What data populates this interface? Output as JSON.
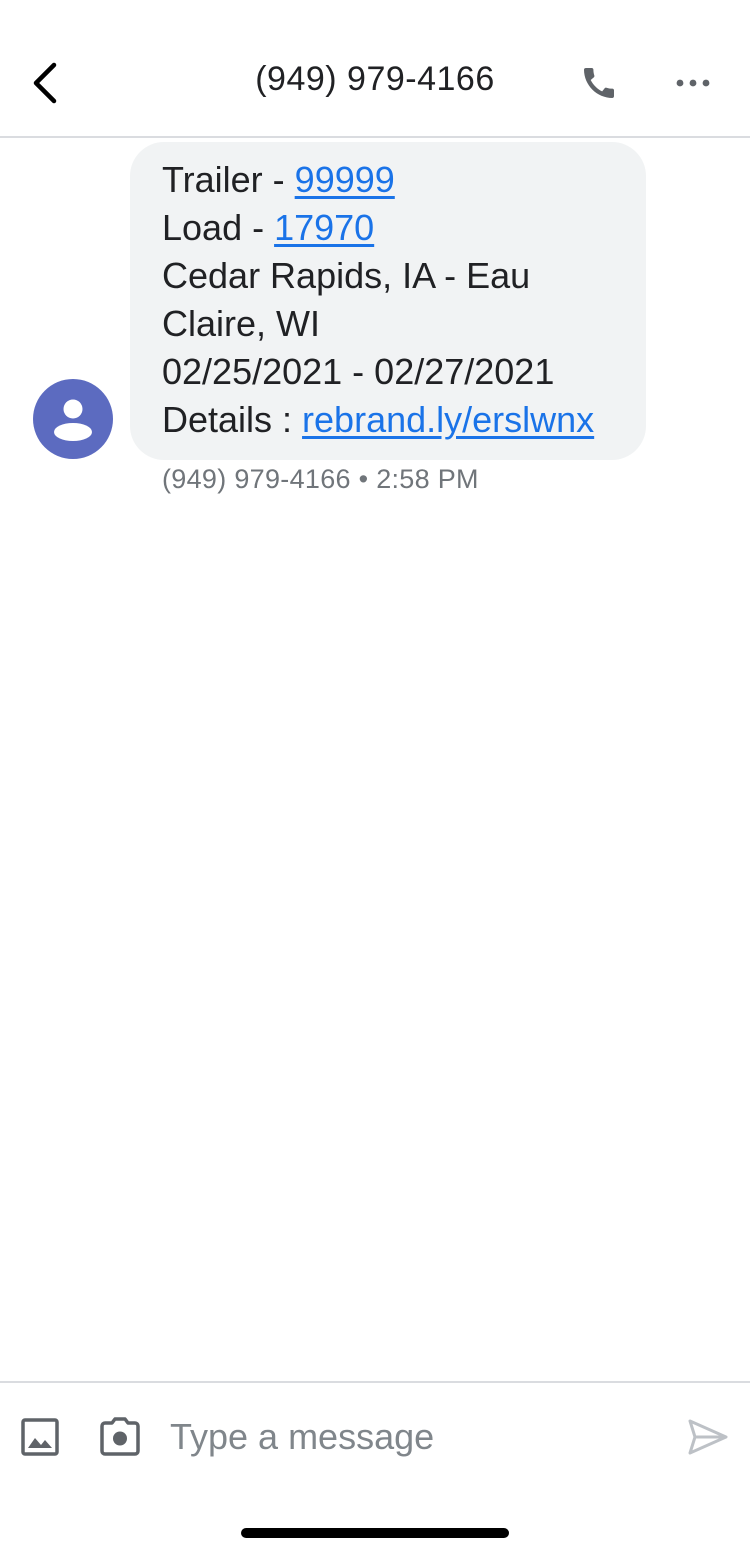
{
  "header": {
    "title": "(949) 979-4166",
    "icons": {
      "back": "chevron-left-icon",
      "call": "phone-icon",
      "more": "more-horizontal-icon"
    }
  },
  "conversation": {
    "avatar_icon": "person-icon",
    "avatar_color": "#5c6bc0",
    "message": {
      "trailer_label": "Trailer - ",
      "trailer_link": "99999",
      "load_label": "Load - ",
      "load_link": "17970",
      "route_line1": "Cedar Rapids, IA - Eau",
      "route_line2": "Claire, WI",
      "dates": "02/25/2021 - 02/27/2021",
      "details_label": "Details : ",
      "details_link": "rebrand.ly/erslwnx"
    },
    "meta": "(949) 979-4166 • 2:58 PM"
  },
  "composer": {
    "placeholder": "Type a message",
    "value": "",
    "icons": {
      "gallery": "image-icon",
      "camera": "camera-icon",
      "send": "send-icon"
    }
  },
  "colors": {
    "link": "#1a73e8",
    "bubble": "#f1f3f4",
    "divider": "#dadce0"
  }
}
